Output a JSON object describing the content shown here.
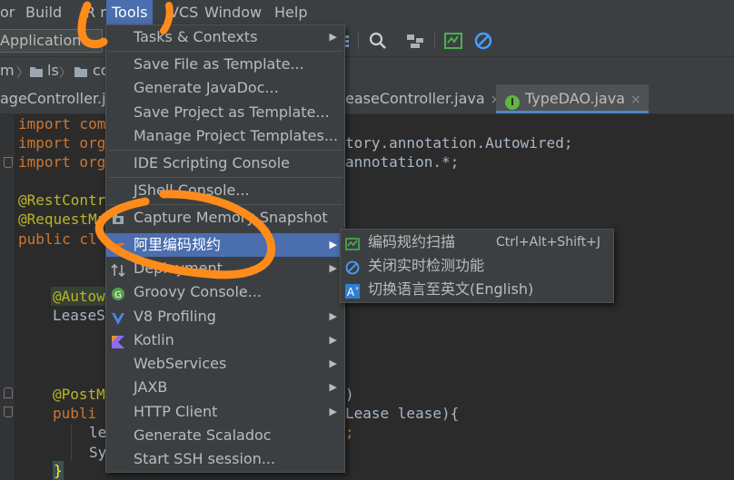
{
  "menubar": {
    "items": [
      {
        "label": "or"
      },
      {
        "label": "Build"
      },
      {
        "label": "R n"
      },
      {
        "label": "Tools"
      },
      {
        "label": "VCS"
      },
      {
        "label": "Window"
      },
      {
        "label": "Help"
      }
    ]
  },
  "toolbar": {
    "run_config": "Application"
  },
  "navbar": {
    "crumbs": [
      "m",
      "ls",
      "co"
    ]
  },
  "tabs": [
    {
      "label": "ageController.ja"
    },
    {
      "label": "easeController.java"
    },
    {
      "label": "TypeDAO.java"
    }
  ],
  "tab_close": "×",
  "code": {
    "lines": [
      {
        "text": "import com"
      },
      {
        "text": "import org"
      },
      {
        "text": "import org"
      },
      {
        "text": "@RestContr"
      },
      {
        "text": "@RequestMa"
      },
      {
        "text": "public cl"
      },
      {
        "text": "@Autow"
      },
      {
        "text": "LeaseS"
      },
      {
        "text": "@PostM"
      },
      {
        "text": "publi"
      },
      {
        "text": "le"
      },
      {
        "text": "Sy"
      },
      {
        "text": "}"
      }
    ],
    "right_fragments": [
      {
        "text": "tory.annotation.Autowired;"
      },
      {
        "text": "annotation.*;"
      },
      {
        "text": ")"
      },
      {
        "text": "Lease lease){"
      },
      {
        "text": ";"
      }
    ]
  },
  "tools_menu": {
    "items": [
      {
        "label": "Tasks & Contexts",
        "submenu": true
      },
      {
        "label": "Save File as Template..."
      },
      {
        "label": "Generate JavaDoc..."
      },
      {
        "label": "Save Project as Template..."
      },
      {
        "label": "Manage Project Templates..."
      },
      {
        "label": "IDE Scripting Console"
      },
      {
        "label": "JShell Console..."
      },
      {
        "label": "Capture Memory Snapshot"
      },
      {
        "label": "阿里编码规约",
        "submenu": true
      },
      {
        "label": "Deployment",
        "submenu": true
      },
      {
        "label": "Groovy Console..."
      },
      {
        "label": "V8 Profiling",
        "submenu": true
      },
      {
        "label": "Kotlin",
        "submenu": true
      },
      {
        "label": "WebServices",
        "submenu": true
      },
      {
        "label": "JAXB",
        "submenu": true
      },
      {
        "label": "HTTP Client",
        "submenu": true
      },
      {
        "label": "Generate Scaladoc"
      },
      {
        "label": "Start SSH session..."
      }
    ],
    "arrow": "▶"
  },
  "submenu": {
    "items": [
      {
        "label": "编码规约扫描",
        "shortcut": "Ctrl+Alt+Shift+J"
      },
      {
        "label": "关闭实时检测功能"
      },
      {
        "label": "切换语言至英文(English)"
      }
    ]
  },
  "colors": {
    "accent": "#4b6eaf",
    "annotation_mark": "#ff8c1a",
    "background": "#2b2b2b"
  }
}
